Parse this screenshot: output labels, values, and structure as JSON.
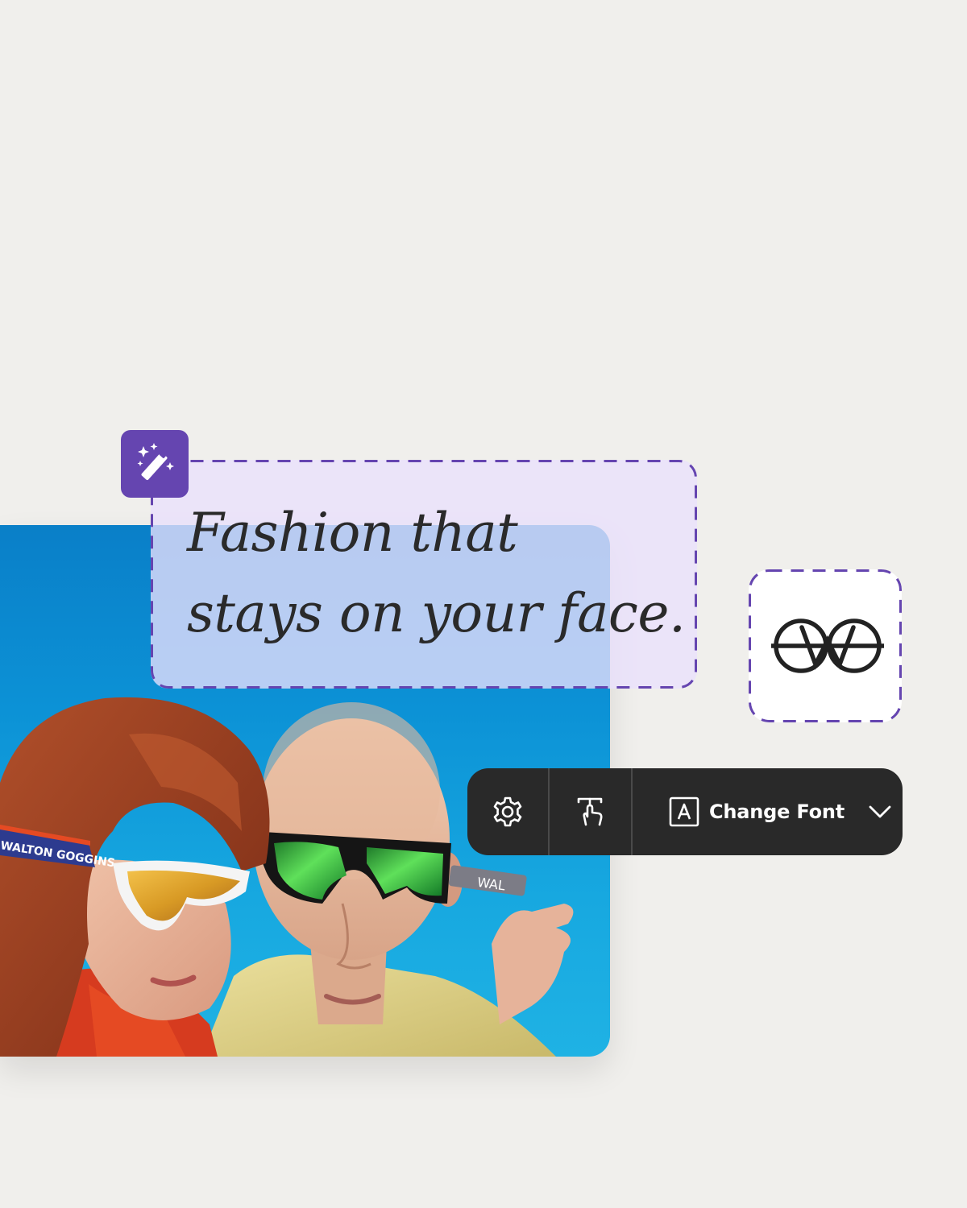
{
  "headline": {
    "line1": "Fashion that",
    "line2": "stays on your face."
  },
  "toolbar": {
    "settings_icon": "gear-icon",
    "text_tool_icon": "text-hand-icon",
    "font_icon": "font-a-box-icon",
    "change_font_label": "Change Font",
    "dropdown_icon": "chevron-down-icon"
  },
  "badge": {
    "icon": "magic-wand-icon",
    "color": "#6545b0"
  },
  "logo": {
    "icon": "glasses-logo-icon"
  },
  "photo": {
    "headband_text": "WALTON GOGGINS",
    "strap_text": "WAL"
  },
  "colors": {
    "background": "#f0efec",
    "accent_purple": "#6545b0",
    "selection_fill": "#ece4fb",
    "toolbar_bg": "#292929",
    "photo_sky": "#0c92d6"
  }
}
